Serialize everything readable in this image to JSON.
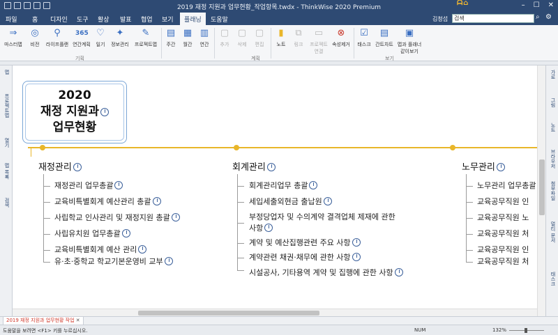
{
  "window": {
    "title": "2019 재정 지원과 업무현황_작업항목.twdx - ThinkWise 2020 Premium"
  },
  "tabs": [
    "파일",
    "홈",
    "디자인",
    "도구",
    "활상",
    "발표",
    "협업",
    "보기",
    "플래닝",
    "도움말"
  ],
  "active_tab": "플래닝",
  "header": {
    "user": "김청섭",
    "search_placeholder": "검색",
    "logo": "ᗩ⌂"
  },
  "ribbon": {
    "buttons": [
      {
        "label": "마스터맵",
        "icon": "master-map-icon",
        "glyph": "⇒"
      },
      {
        "label": "비전",
        "icon": "target-icon",
        "glyph": "◎"
      },
      {
        "label": "라이프플랜",
        "icon": "lifeplan-icon",
        "glyph": "⚲"
      },
      {
        "label": "연간계획",
        "icon": "year-plan-icon",
        "glyph": "365"
      },
      {
        "label": "일기",
        "icon": "diary-icon",
        "glyph": "♡"
      },
      {
        "label": "정보관리",
        "icon": "info-icon",
        "glyph": "✦"
      },
      {
        "label": "프로젝트맵",
        "icon": "project-map-icon",
        "glyph": "✎"
      },
      {
        "label": "주간",
        "icon": "week-icon",
        "glyph": "▤"
      },
      {
        "label": "월간",
        "icon": "month-icon",
        "glyph": "▦"
      },
      {
        "label": "연간",
        "icon": "year-icon",
        "glyph": "▥"
      },
      {
        "label": "추가",
        "icon": "add-icon",
        "glyph": "▢"
      },
      {
        "label": "삭제",
        "icon": "delete-icon",
        "glyph": "▢"
      },
      {
        "label": "편집",
        "icon": "edit-icon",
        "glyph": "▢"
      },
      {
        "label": "노트",
        "icon": "note-icon",
        "glyph": "▮"
      },
      {
        "label": "링크",
        "icon": "link-icon",
        "glyph": "⧉"
      },
      {
        "label": "프로젝트 연결",
        "icon": "project-link-icon",
        "glyph": "▭"
      },
      {
        "label": "속성제거",
        "icon": "remove-attr-icon",
        "glyph": "⊗"
      },
      {
        "label": "태스크",
        "icon": "task-icon",
        "glyph": "☑"
      },
      {
        "label": "간트차트",
        "icon": "gantt-icon",
        "glyph": "▤"
      },
      {
        "label": "맵과 플래너 같이보기",
        "icon": "map-planner-icon",
        "glyph": "▣"
      }
    ],
    "groups": [
      "기획",
      "계획",
      "보기"
    ]
  },
  "left_panel": [
    "맵",
    "프로젝트맵",
    "열기",
    "맵 목록",
    "검색"
  ],
  "right_panel": [
    "가로",
    "그림",
    "노트",
    "브라우저",
    "첨부파일",
    "멀티 문서",
    "태스크"
  ],
  "map": {
    "central_lines": [
      "2020",
      "재정 지원과",
      "업무현황"
    ],
    "branches": [
      {
        "label": "재정관리",
        "items": [
          "재정관리 업무총괄",
          "교육비특별회계 예산관리 총괄",
          "사립학교 인사관리 및 재정지원 총괄",
          "사립유치원 업무총괄",
          "교육비특별회계 예산 관리",
          "유·초·중학교 학교기본운영비 교부"
        ]
      },
      {
        "label": "회계관리",
        "items": [
          "회계관리업무 총괄",
          "세입세출외현금 출납원",
          "부정당업자 및 수의계약 결격업체 제재에 관한 사항",
          "계약 및 예산집행관련 주요 사항",
          "계약관련 채권·채무에 관한 사항",
          "시설공사, 기타용역 계약 및 집행에 관한 사항"
        ]
      },
      {
        "label": "노무관리",
        "items": [
          "노무관리 업무총괄",
          "교육공무직원 인",
          "교육공무직원 노",
          "교육공무직원 처",
          "교육공무직원 인",
          "교육공무직원 처"
        ]
      }
    ]
  },
  "doc_tab": "2019 재정 지원과 업무현황 작업",
  "status": {
    "help": "도움말을 보려면 <F1> 키를 누르십시오.",
    "num": "NUM",
    "zoom": "132%"
  },
  "colors": {
    "accent": "#e9b62a",
    "titlebar": "#2e4a73"
  }
}
